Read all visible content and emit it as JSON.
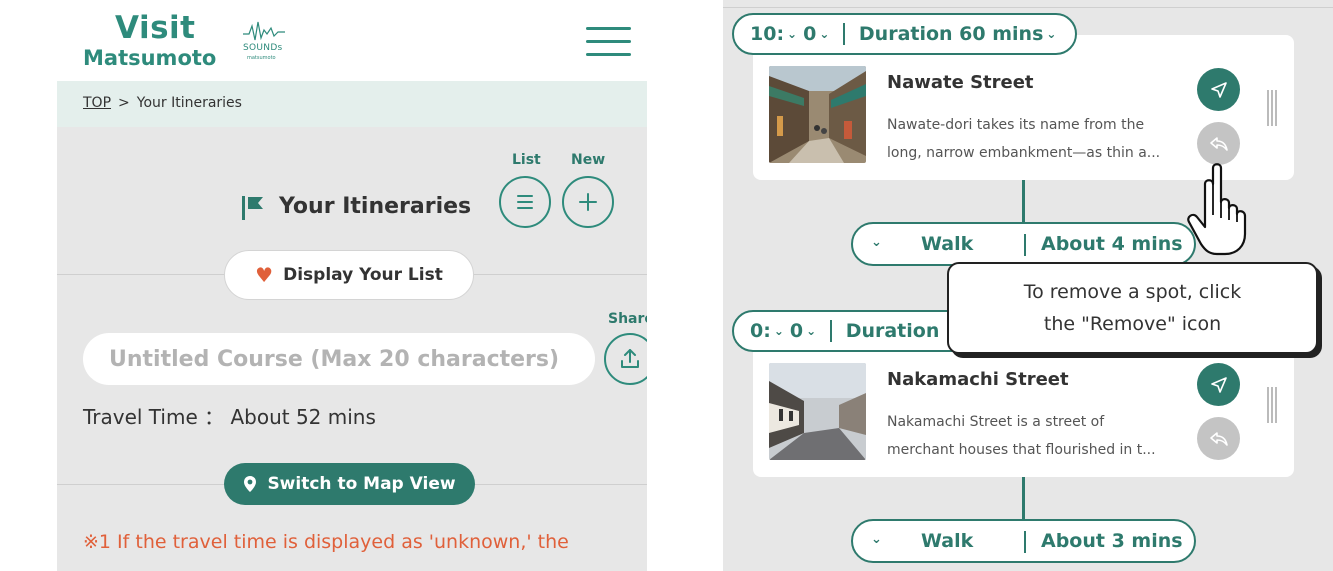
{
  "header": {
    "logo_visit": "Visit",
    "logo_matsumoto": "Matsumoto",
    "logo_sounds": "SOUNDs",
    "logo_sounds_sub": "matsumoto",
    "menu_icon": "hamburger-menu-icon"
  },
  "breadcrumb": {
    "home": "TOP",
    "separator": ">",
    "current": "Your Itineraries"
  },
  "itinerary_panel": {
    "list_label": "List",
    "new_label": "New",
    "title": "Your Itineraries",
    "display_list_label": "Display Your List",
    "course_name_placeholder": "Untitled Course (Max 20 characters)",
    "share_label": "Share",
    "travel_time": "Travel Time ： About 52 mins",
    "map_view_label": "Switch to Map View",
    "note_line1": "※1 If the travel time is displayed as 'unknown,' the",
    "note_line2": "   ...          ...   ...             ...            ...",
    "colors": {
      "accent": "#2e7a6d",
      "note": "#e0603a",
      "heart": "#e0603a"
    }
  },
  "timeline": {
    "slots": [
      {
        "hour": "10:",
        "minute": "0",
        "duration": "Duration 60 mins",
        "spot": {
          "title": "Nawate Street",
          "desc_line1": "Nawate-dori takes its name from the",
          "desc_line2": "long, narrow embankment—as thin a..."
        },
        "move": {
          "mode": "Walk",
          "duration": "About 4 mins"
        }
      },
      {
        "hour": "0:",
        "minute": "0",
        "duration": "Duration",
        "spot": {
          "title": "Nakamachi Street",
          "desc_line1": "Nakamachi Street is a street of",
          "desc_line2": "merchant houses that flourished in t..."
        },
        "move": {
          "mode": "Walk",
          "duration": "About 3 mins"
        }
      }
    ],
    "tooltip_line1": "To remove a spot, click",
    "tooltip_line2": "the \"Remove\" icon"
  }
}
